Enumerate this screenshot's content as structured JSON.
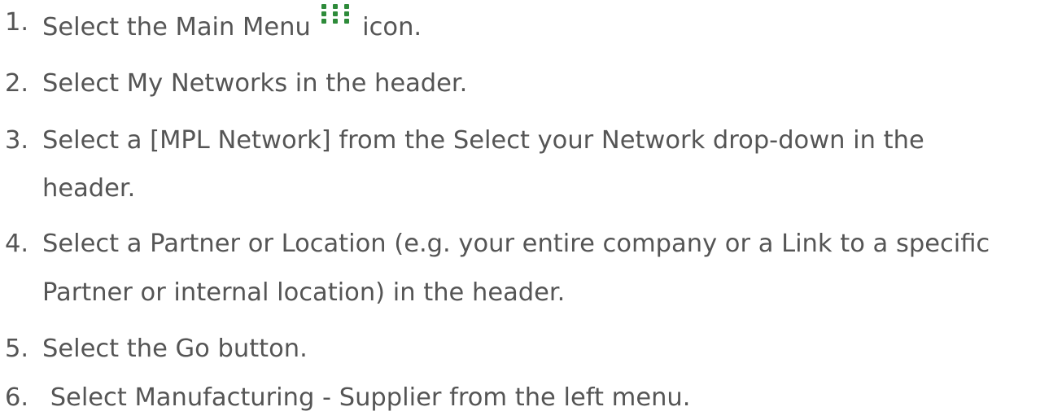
{
  "steps": [
    {
      "num": "1.",
      "pre": "Select the Main Menu",
      "icon": "main-menu-grid-icon",
      "post": "icon."
    },
    {
      "num": "2.",
      "text": "Select My Networks in the header."
    },
    {
      "num": "3.",
      "line1": "Select a [MPL Network] from the Select your Network drop-down in the",
      "line2": "header."
    },
    {
      "num": "4.",
      "line1": "Select a Partner or Location (e.g. your entire company or a Link to a specific",
      "line2": "Partner or internal location) in the header."
    },
    {
      "num": "5.",
      "text": "Select the Go button."
    },
    {
      "num": "6.",
      "text": " Select Manufacturing - Supplier from the left menu."
    }
  ],
  "colors": {
    "text": "#555555",
    "icon": "#2e8b3a"
  }
}
